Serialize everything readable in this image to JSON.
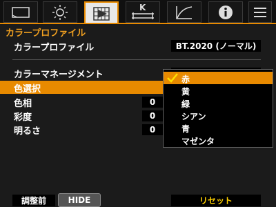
{
  "tabs": [
    {
      "icon": "screen-icon"
    },
    {
      "icon": "brightness-icon"
    },
    {
      "icon": "image-adjust-icon",
      "active": true
    },
    {
      "icon": "black-level-icon",
      "label": "K"
    },
    {
      "icon": "gamma-curve-icon"
    },
    {
      "icon": "info-icon"
    },
    {
      "icon": "menu-icon"
    }
  ],
  "section_title": "カラープロファイル",
  "rows": {
    "profile_label": "カラープロファイル",
    "profile_value": "BT.2020 (ノーマル)",
    "color_management_label": "カラーマネージメント",
    "color_select_label": "色選択",
    "hue_label": "色相",
    "hue_value": "0",
    "saturation_label": "彩度",
    "saturation_value": "0",
    "brightness_label": "明るさ",
    "brightness_value": "0"
  },
  "dropdown": {
    "options": [
      "赤",
      "黄",
      "緑",
      "シアン",
      "青",
      "マゼンタ"
    ],
    "selected_index": 0
  },
  "footer": {
    "adjust_label": "調整前",
    "hide_label": "HIDE",
    "reset_label": "リセット"
  },
  "colors": {
    "accent": "#e88a00",
    "reset_text": "#ffd000",
    "title": "#f0a020"
  }
}
